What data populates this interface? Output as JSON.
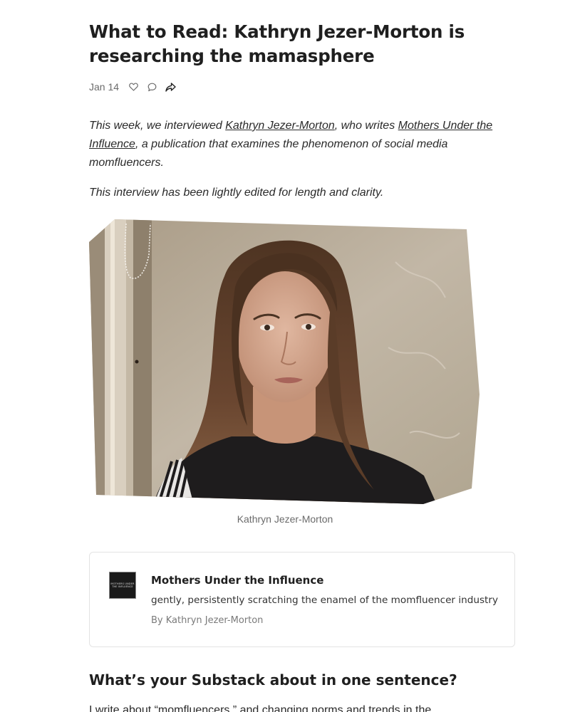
{
  "post": {
    "title": "What to Read: Kathryn Jezer-Morton is researching the mamasphere",
    "date": "Jan 14"
  },
  "actions": {
    "like_icon": "heart-outline-icon",
    "comment_icon": "comment-bubble-icon",
    "share_icon": "share-arrow-icon"
  },
  "intro": {
    "p1_prefix": "This week, we interviewed ",
    "p1_link1": "Kathryn Jezer-Morton",
    "p1_middle": ", who writes ",
    "p1_link2": "Mothers Under the Influence",
    "p1_suffix": ", a publication that examines the phenomenon of social media momfluencers.",
    "p2": "This interview has been lightly edited for length and clarity."
  },
  "photo": {
    "caption": "Kathryn Jezer-Morton"
  },
  "embed": {
    "logo_line1": "MOTHERS UNDER",
    "logo_line2": "THE INFLUENCE",
    "name": "Mothers Under the Influence",
    "description": "gently, persistently scratching the enamel of the momfluencer industry",
    "author": "By Kathryn Jezer-Morton"
  },
  "question1": {
    "heading": "What’s your Substack about in one sentence?",
    "answer_start": "I write about “momfluencers,” and changing norms and trends in the"
  },
  "colors": {
    "text": "#222222",
    "muted": "#6b6b6b",
    "border": "#e3e3e3"
  }
}
